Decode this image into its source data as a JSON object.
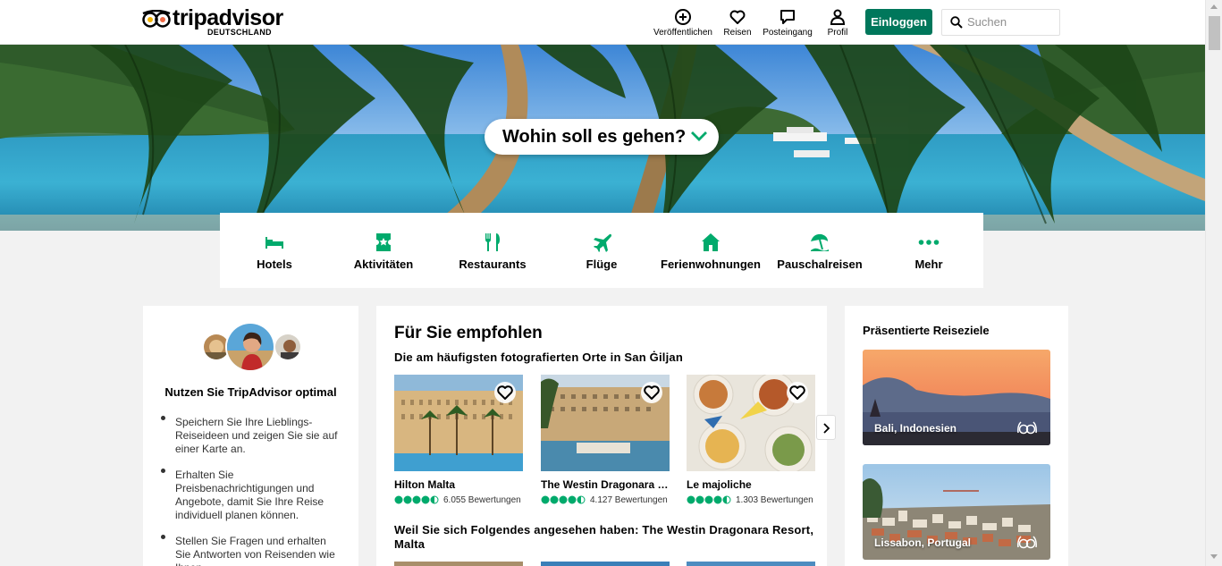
{
  "header": {
    "logo_text": "tripadvisor",
    "logo_sub": "DEUTSCHLAND",
    "nav": [
      {
        "label": "Veröffentlichen",
        "icon": "plus-circle-icon"
      },
      {
        "label": "Reisen",
        "icon": "heart-icon"
      },
      {
        "label": "Posteingang",
        "icon": "chat-icon"
      },
      {
        "label": "Profil",
        "icon": "person-icon"
      }
    ],
    "login_label": "Einloggen",
    "search_placeholder": "Suchen"
  },
  "hero": {
    "question": "Wohin soll es gehen?"
  },
  "categories": [
    {
      "label": "Hotels",
      "icon": "bed-icon"
    },
    {
      "label": "Aktivitäten",
      "icon": "ticket-icon"
    },
    {
      "label": "Restaurants",
      "icon": "fork-knife-icon"
    },
    {
      "label": "Flüge",
      "icon": "plane-icon"
    },
    {
      "label": "Ferienwohnungen",
      "icon": "house-icon"
    },
    {
      "label": "Pauschalreisen",
      "icon": "beach-umbrella-icon"
    },
    {
      "label": "Mehr",
      "icon": "more-dots-icon"
    }
  ],
  "promo": {
    "title": "Nutzen Sie TripAdvisor optimal",
    "bullets": [
      "Speichern Sie Ihre Lieblings-Reiseideen und zeigen Sie sie auf einer Karte an.",
      "Erhalten Sie Preisbenachrichtigungen und Angebote, damit Sie Ihre Reise individuell planen können.",
      "Stellen Sie Fragen und erhalten Sie Antworten von Reisenden wie Ihnen."
    ]
  },
  "recommended": {
    "title": "Für Sie empfohlen",
    "section1": "Die am häufigsten fotografierten Orte in San Ġiljan",
    "items": [
      {
        "name": "Hilton Malta",
        "reviews": "6.055 Bewertungen",
        "rating": 4.5
      },
      {
        "name": "The Westin Dragonara Resort, Malta",
        "reviews": "4.127 Bewertungen",
        "rating": 4.5
      },
      {
        "name": "Le majoliche",
        "reviews": "1.303 Bewertungen",
        "rating": 4.5
      }
    ],
    "section2": "Weil Sie sich Folgendes angesehen haben: The Westin Dragonara Resort, Malta"
  },
  "featured": {
    "title": "Präsentierte Reiseziele",
    "destinations": [
      {
        "label": "Bali, Indonesien"
      },
      {
        "label": "Lissabon, Portugal"
      }
    ]
  },
  "colors": {
    "brand_green": "#00775b",
    "icon_green": "#00aa6c",
    "rating_green": "#00aa6c"
  }
}
